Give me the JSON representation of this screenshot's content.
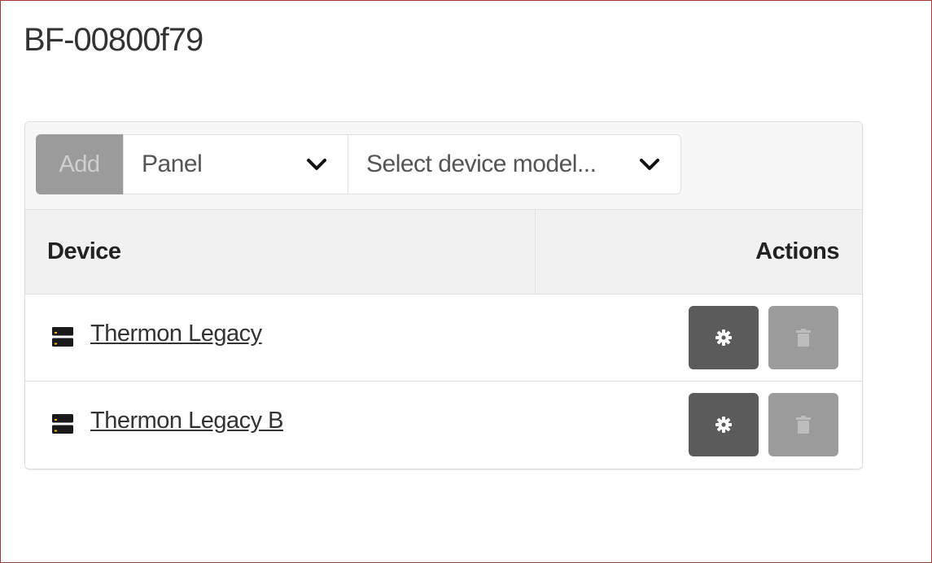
{
  "page": {
    "title": "BF-00800f79"
  },
  "toolbar": {
    "add_label": "Add",
    "type_select": {
      "value": "Panel"
    },
    "model_select": {
      "value": "Select device model..."
    }
  },
  "table": {
    "headers": {
      "device": "Device",
      "actions": "Actions"
    },
    "rows": [
      {
        "device": "Thermon Legacy",
        "icon": "server-icon",
        "actions": [
          "gear-icon",
          "trash-icon"
        ]
      },
      {
        "device": "Thermon Legacy B",
        "icon": "server-icon",
        "actions": [
          "gear-icon",
          "trash-icon"
        ]
      }
    ]
  },
  "colors": {
    "frame_border": "#a33a3a",
    "add_button": "#9b9b9b",
    "settings_button": "#5b5b5b",
    "delete_button_disabled": "#9b9b9b",
    "header_bg": "#f1f1f1"
  }
}
